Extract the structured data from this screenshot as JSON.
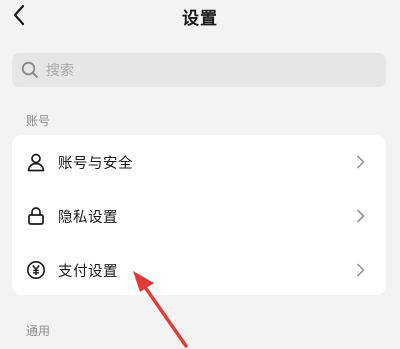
{
  "header": {
    "title": "设置",
    "back_icon": "chevron-left-icon"
  },
  "search": {
    "placeholder": "搜索",
    "icon": "search-icon"
  },
  "sections": {
    "account": {
      "label": "账号",
      "items": [
        {
          "label": "账号与安全",
          "icon": "user-icon"
        },
        {
          "label": "隐私设置",
          "icon": "lock-icon"
        },
        {
          "label": "支付设置",
          "icon": "yuan-icon"
        }
      ]
    },
    "general": {
      "label": "通用"
    }
  },
  "annotation": {
    "color": "#e53935",
    "icon": "red-arrow-annotation"
  },
  "colors": {
    "background": "#f3f3f3",
    "card": "#ffffff",
    "search_bg": "#e6e6e6"
  }
}
